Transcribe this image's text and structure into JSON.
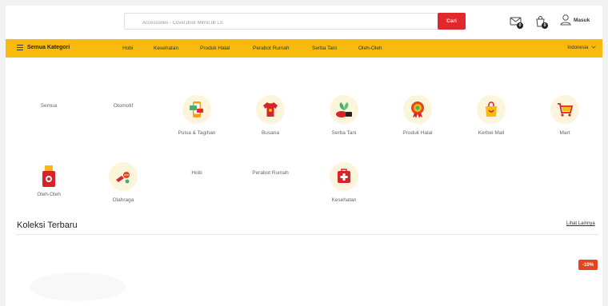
{
  "search": {
    "placeholder": "Accessories - Cover,door Mirror,dll LS",
    "button_label": "Cari"
  },
  "header": {
    "mail_count": "0",
    "bag_count": "0",
    "login_label": "Masuk"
  },
  "nav": {
    "all_categories_label": "Semua Kategori",
    "items": [
      "Hobi",
      "Kesehatan",
      "Produk Halal",
      "Perabot Rumah",
      "Serba Tani",
      "Oleh-Oleh"
    ],
    "language": "Indonesia"
  },
  "categories": [
    {
      "label": "Semua",
      "icon": "none"
    },
    {
      "label": "Otomotif",
      "icon": "none"
    },
    {
      "label": "Pulsa & Tagihan",
      "icon": "phone-bills-icon"
    },
    {
      "label": "Busana",
      "icon": "tshirt-icon"
    },
    {
      "label": "Serba Tani",
      "icon": "plant-icon"
    },
    {
      "label": "Produk Halal",
      "icon": "halal-badge-icon"
    },
    {
      "label": "Kerbel Mall",
      "icon": "shopping-bag-icon"
    },
    {
      "label": "Mart",
      "icon": "cart-icon"
    },
    {
      "label": "Oleh-Oleh",
      "icon": "gift-jar-icon"
    },
    {
      "label": "Olahraga",
      "icon": "sports-icon"
    },
    {
      "label": "Hobi",
      "icon": "none"
    },
    {
      "label": "Perabot Rumah",
      "icon": "none"
    },
    {
      "label": "Kesehatan",
      "icon": "first-aid-icon"
    }
  ],
  "collection": {
    "title": "Koleksi Terbaru",
    "more_label": "Lihat Lainnya",
    "discount": "-10%"
  },
  "colors": {
    "accent_yellow": "#f8ba0d",
    "button_red": "#e1292b",
    "discount_red": "#e1461f"
  }
}
